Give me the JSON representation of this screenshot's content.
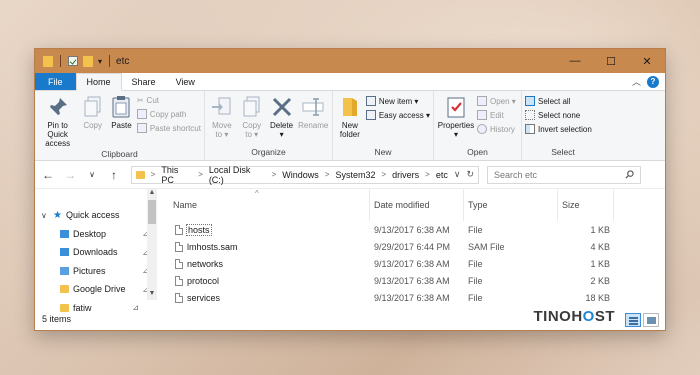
{
  "window": {
    "title": "etc",
    "controls": {
      "minimize": "—",
      "maximize": "☐",
      "close": "✕"
    }
  },
  "tabs": {
    "file": "File",
    "home": "Home",
    "share": "Share",
    "view": "View"
  },
  "ribbon": {
    "clipboard": {
      "label": "Clipboard",
      "pin_line1": "Pin to Quick",
      "pin_line2": "access",
      "copy": "Copy",
      "paste": "Paste",
      "cut": "Cut",
      "copy_path": "Copy path",
      "paste_shortcut": "Paste shortcut"
    },
    "organize": {
      "label": "Organize",
      "move_to": "Move",
      "move_to2": "to ▾",
      "copy_to": "Copy",
      "copy_to2": "to ▾",
      "delete": "Delete",
      "delete2": "▾",
      "rename": "Rename"
    },
    "new": {
      "label": "New",
      "new_folder": "New",
      "new_folder2": "folder",
      "new_item": "New item ▾",
      "easy_access": "Easy access ▾"
    },
    "open": {
      "label": "Open",
      "properties": "Properties",
      "properties2": "▾",
      "open": "Open ▾",
      "edit": "Edit",
      "history": "History"
    },
    "select": {
      "label": "Select",
      "select_all": "Select all",
      "select_none": "Select none",
      "invert": "Invert selection"
    }
  },
  "address": {
    "back": "←",
    "forward": "→",
    "recent": "∨",
    "up": "↑",
    "crumbs": [
      "This PC",
      "Local Disk (C:)",
      "Windows",
      "System32",
      "drivers",
      "etc"
    ],
    "sep": ">",
    "dropdown": "∨",
    "refresh": "↻",
    "search_placeholder": "Search etc"
  },
  "nav": {
    "quick_access": "Quick access",
    "items": [
      {
        "label": "Desktop",
        "pin": "📌"
      },
      {
        "label": "Downloads",
        "pin": "📌"
      },
      {
        "label": "Pictures",
        "pin": "📌"
      },
      {
        "label": "Google Drive",
        "pin": "📌"
      },
      {
        "label": "fatiw",
        "pin": "📌"
      }
    ]
  },
  "columns": {
    "name": "Name",
    "date": "Date modified",
    "type": "Type",
    "size": "Size"
  },
  "files": [
    {
      "name": "hosts",
      "date": "9/13/2017 6:38 AM",
      "type": "File",
      "size": "1 KB"
    },
    {
      "name": "lmhosts.sam",
      "date": "9/29/2017 6:44 PM",
      "type": "SAM File",
      "size": "4 KB"
    },
    {
      "name": "networks",
      "date": "9/13/2017 6:38 AM",
      "type": "File",
      "size": "1 KB"
    },
    {
      "name": "protocol",
      "date": "9/13/2017 6:38 AM",
      "type": "File",
      "size": "2 KB"
    },
    {
      "name": "services",
      "date": "9/13/2017 6:38 AM",
      "type": "File",
      "size": "18 KB"
    }
  ],
  "status": {
    "count": "5 items"
  },
  "brand": {
    "part1": "TINOH",
    "part2": "O",
    "part3": "ST"
  }
}
